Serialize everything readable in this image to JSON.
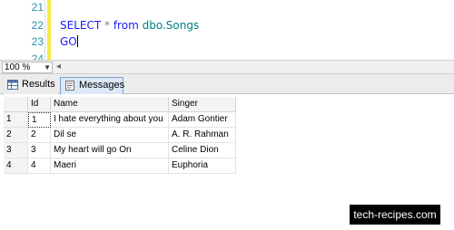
{
  "editor": {
    "lines": [
      {
        "number": "21",
        "code": ""
      },
      {
        "number": "22",
        "kw1": "SELECT",
        "star": " * ",
        "kw2": "from",
        "obj": " dbo.Songs"
      },
      {
        "number": "23",
        "go": "GO"
      },
      {
        "number": "24"
      }
    ]
  },
  "zoom": {
    "value": "100 %"
  },
  "tabs": {
    "results": "Results",
    "messages": "Messages"
  },
  "grid": {
    "columns": [
      "Id",
      "Name",
      "Singer"
    ],
    "rows": [
      {
        "rownum": "1",
        "id": "1",
        "name": "I hate everything about you",
        "singer": "Adam Gontier"
      },
      {
        "rownum": "2",
        "id": "2",
        "name": "Dil se",
        "singer": "A. R. Rahman"
      },
      {
        "rownum": "3",
        "id": "3",
        "name": "My heart will go On",
        "singer": "Celine Dion"
      },
      {
        "rownum": "4",
        "id": "4",
        "name": "Maeri",
        "singer": "Euphoria"
      }
    ]
  },
  "watermark": "tech-recipes.com"
}
